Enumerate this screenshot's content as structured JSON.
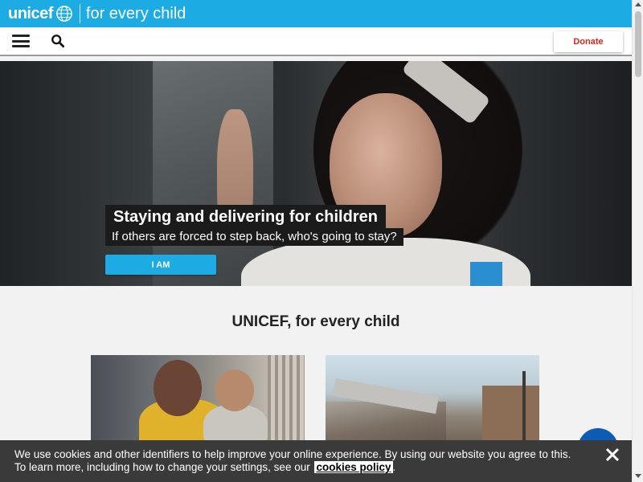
{
  "brand": {
    "logo_text": "unicef",
    "tagline": "for every child",
    "color": "#1cabe2"
  },
  "nav": {
    "menu_icon": "hamburger-menu-icon",
    "search_icon": "search-icon",
    "donate_label": "Donate",
    "donate_color": "#e2231a"
  },
  "hero": {
    "title": "Staying and delivering for children",
    "subtitle": "If others are forced to step back, who's going to stay?",
    "cta_label": "I AM"
  },
  "section": {
    "heading": "UNICEF, for every child"
  },
  "cards": [
    {
      "image": "mother-holding-baby-photo"
    },
    {
      "image": "damaged-buildings-street-photo"
    }
  ],
  "cookie": {
    "line1": "We use cookies and other identifiers to help improve your online experience. By using our website you agree to this.",
    "line2_prefix": "To learn more, including how to change your settings, see our",
    "link_text": "cookies policy",
    "line2_suffix": ".",
    "close_icon": "close-icon"
  }
}
